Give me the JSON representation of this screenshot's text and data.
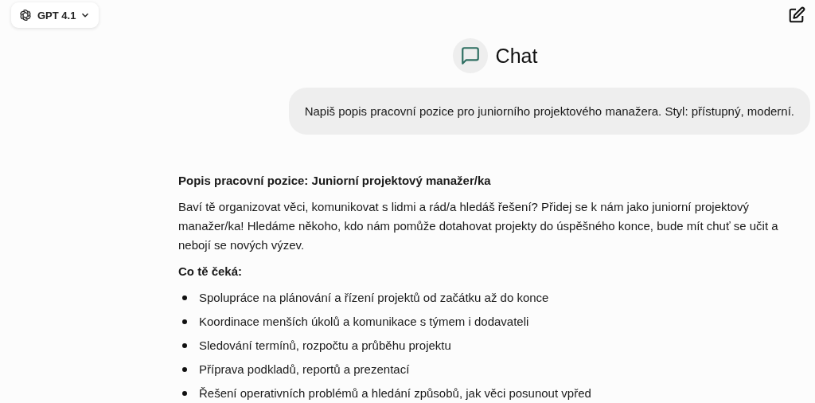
{
  "model_selector": {
    "label": "GPT 4.1"
  },
  "chat_header": {
    "title": "Chat"
  },
  "user_message": "Napiš popis pracovní pozice pro juniorního projektového manažera. Styl: přístupný, moderní.",
  "response": {
    "heading": "Popis pracovní pozice: Juniorní projektový manažer/ka",
    "intro": "Baví tě organizovat věci, komunikovat s lidmi a rád/a hledáš řešení? Přidej se k nám jako juniorní projektový manažer/ka! Hledáme někoho, kdo nám pomůže dotahovat projekty do úspěšného konce, bude mít chuť se učit a nebojí se nových výzev.",
    "subheading": "Co tě čeká:",
    "bullets": [
      "Spolupráce na plánování a řízení projektů od začátku až do konce",
      "Koordinace menších úkolů a komunikace s týmem i dodavateli",
      "Sledování termínů, rozpočtu a průběhu projektu",
      "Příprava podkladů, reportů a prezentací",
      "Řešení operativních problémů a hledání způsobů, jak věci posunout vpřed"
    ]
  }
}
